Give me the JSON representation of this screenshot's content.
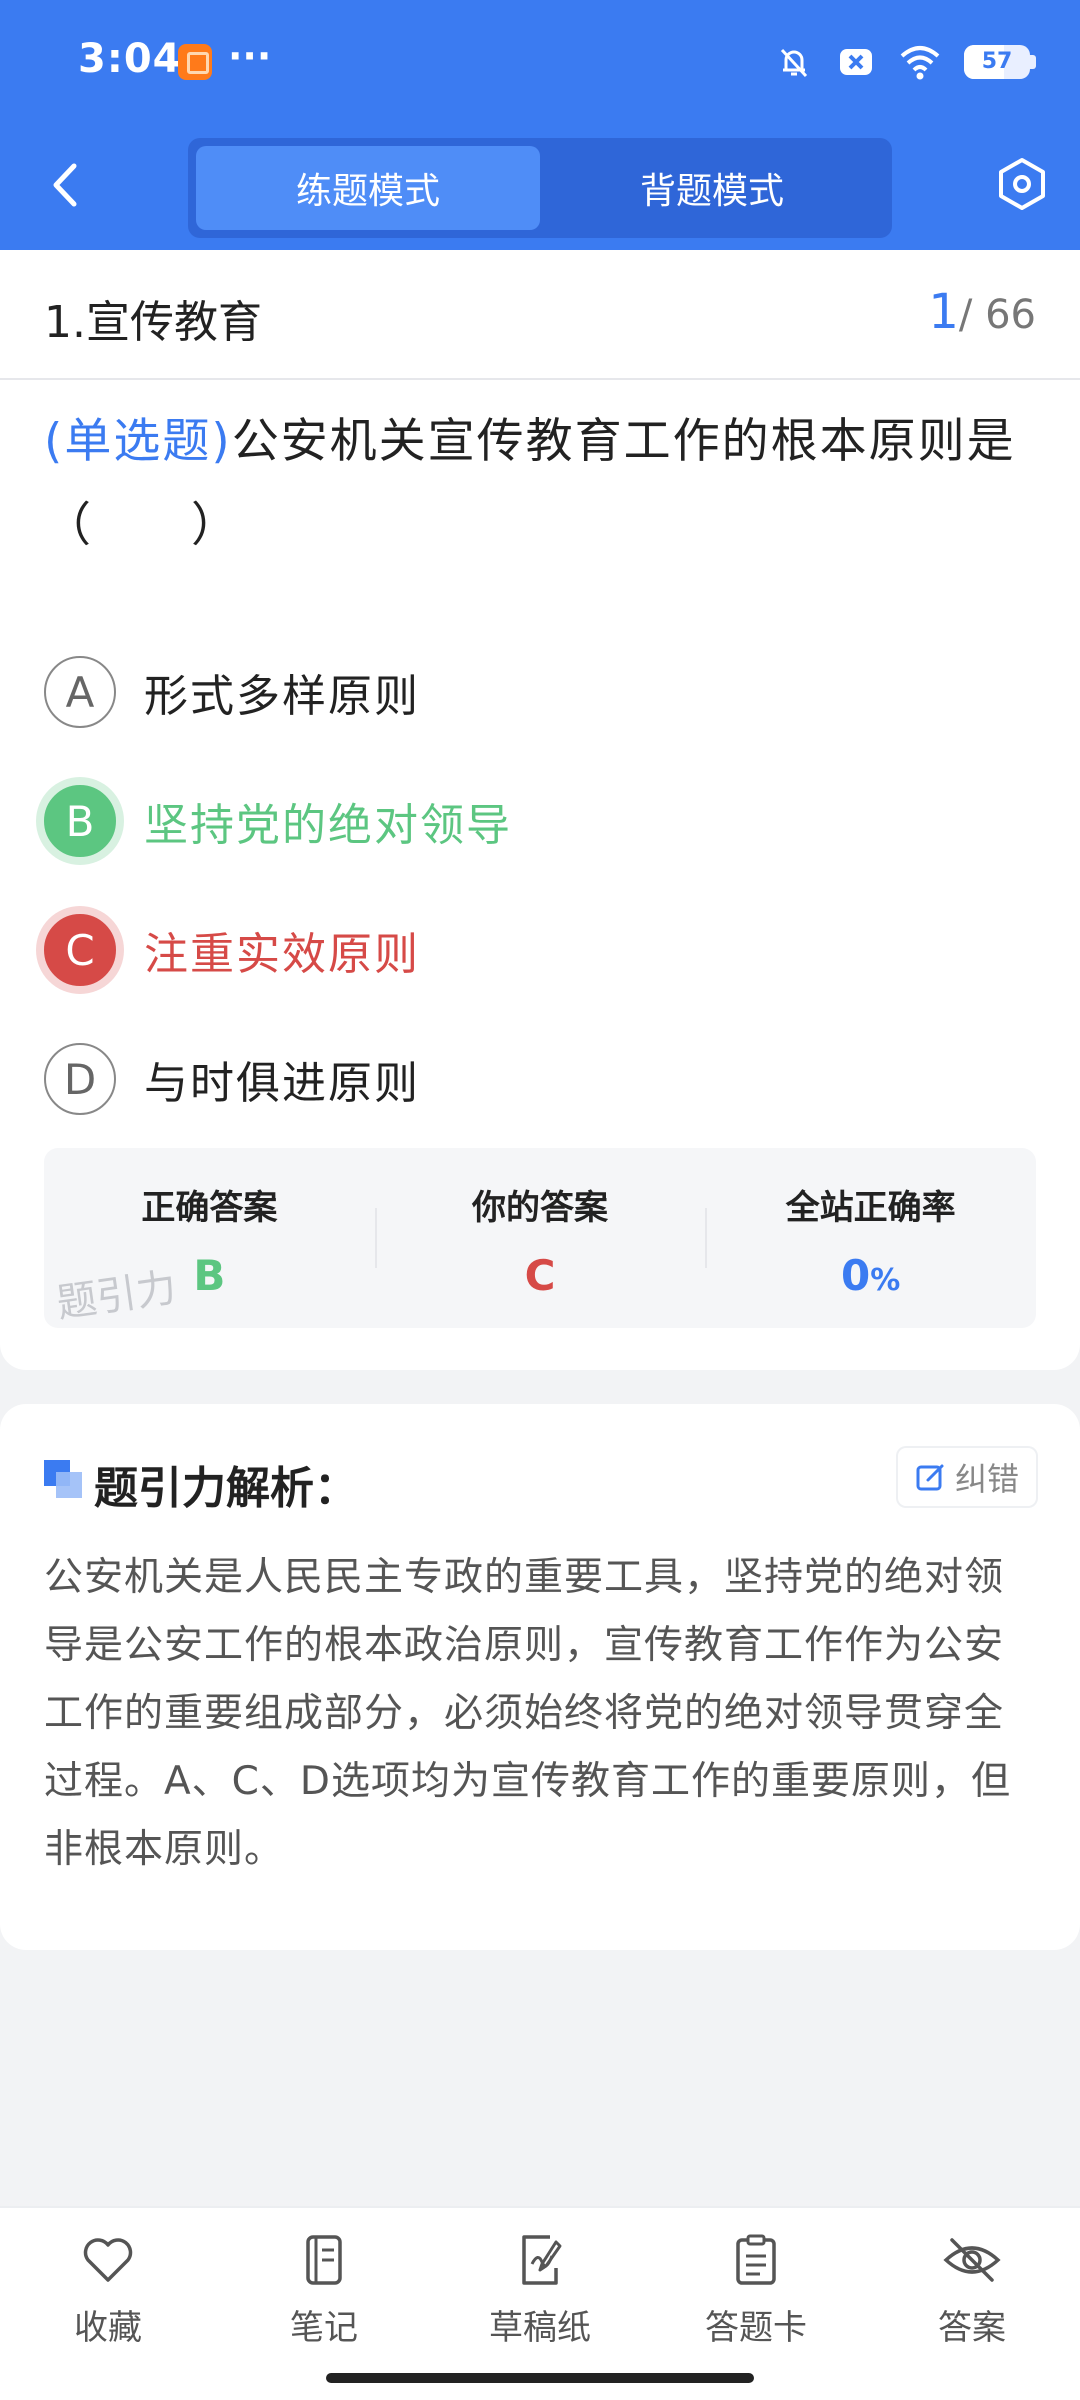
{
  "status_bar": {
    "time": "3:04",
    "more": "···",
    "battery": "57"
  },
  "header": {
    "modes": [
      "练题模式",
      "背题模式"
    ],
    "active_mode": "练题模式"
  },
  "question": {
    "title": "1.宣传教育",
    "current": "1",
    "total": "/ 66",
    "type": "(单选题)",
    "text": "公安机关宣传教育工作的根本原则是（　　）",
    "options": [
      {
        "letter": "A",
        "label": "形式多样原则"
      },
      {
        "letter": "B",
        "label": "坚持党的绝对领导"
      },
      {
        "letter": "C",
        "label": "注重实效原则"
      },
      {
        "letter": "D",
        "label": "与时俱进原则"
      }
    ]
  },
  "result": {
    "correct_label": "正确答案",
    "correct_value": "B",
    "your_label": "你的答案",
    "your_value": "C",
    "rate_label": "全站正确率",
    "rate_value": "0",
    "rate_unit": "%",
    "watermark": "题引力"
  },
  "analysis": {
    "title": "题引力解析：",
    "fix_label": "纠错",
    "text": "公安机关是人民民主专政的重要工具，坚持党的绝对领导是公安工作的根本政治原则，宣传教育工作作为公安工作的重要组成部分，必须始终将党的绝对领导贯穿全过程。A、C、D选项均为宣传教育工作的重要原则，但非根本原则。"
  },
  "bottom_tabs": [
    "收藏",
    "笔记",
    "草稿纸",
    "答题卡",
    "答案"
  ],
  "colors": {
    "primary": "#3b7bf1",
    "correct": "#5cc681",
    "wrong": "#d64a47"
  }
}
